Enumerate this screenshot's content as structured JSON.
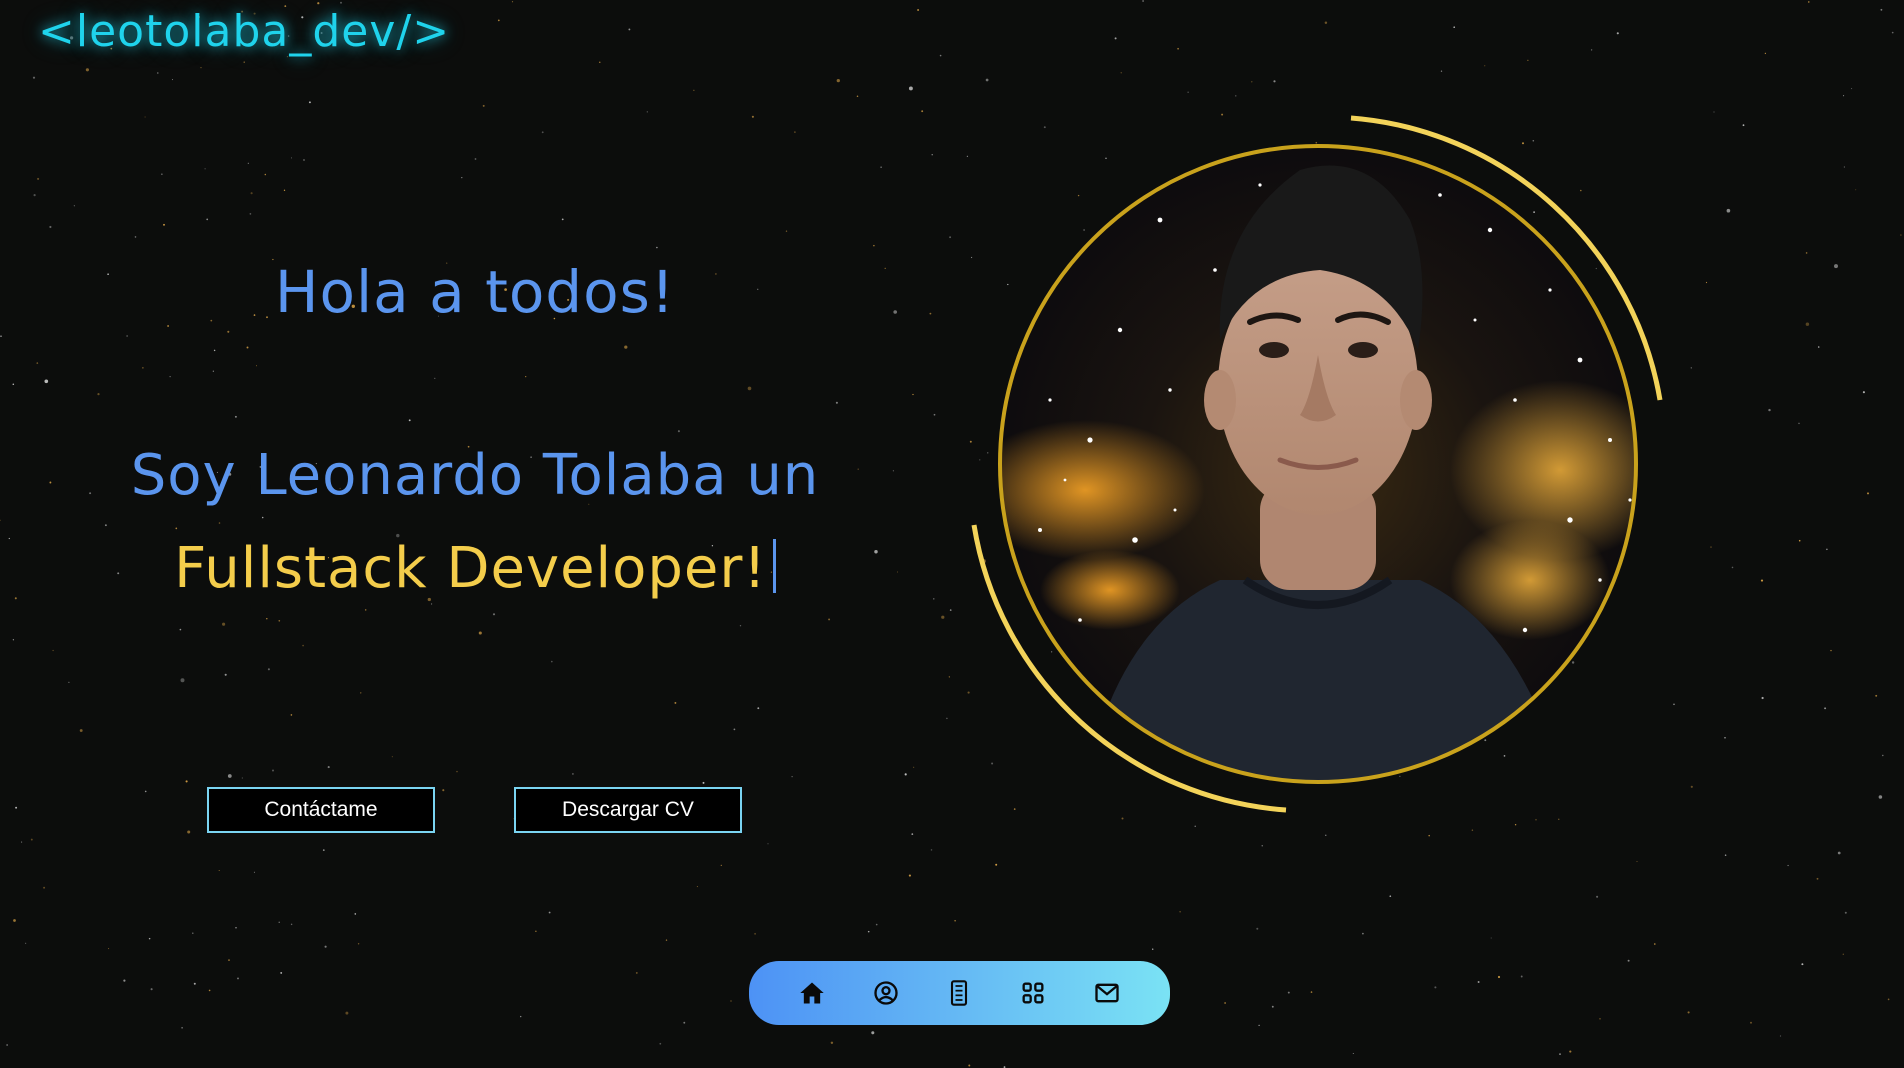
{
  "header": {
    "logo_text": "<leotolaba_dev/>"
  },
  "hero": {
    "greeting": "Hola a todos!",
    "intro": "Soy Leonardo Tolaba un",
    "role": "Fullstack Developer!"
  },
  "actions": {
    "contact_label": "Contáctame",
    "cv_label": "Descargar CV"
  },
  "nav": {
    "items": [
      {
        "icon": "home-icon"
      },
      {
        "icon": "user-circle-icon"
      },
      {
        "icon": "document-icon"
      },
      {
        "icon": "grid-icon"
      },
      {
        "icon": "mail-icon"
      }
    ]
  },
  "colors": {
    "background": "#0c0d0c",
    "logo": "#1fd3ec",
    "heading_blue": "#5b95ee",
    "accent_gold": "#f4cd4b",
    "button_border": "#7ad4f2",
    "nav_gradient_start": "#4d92f5",
    "nav_gradient_end": "#7ae2f4"
  }
}
